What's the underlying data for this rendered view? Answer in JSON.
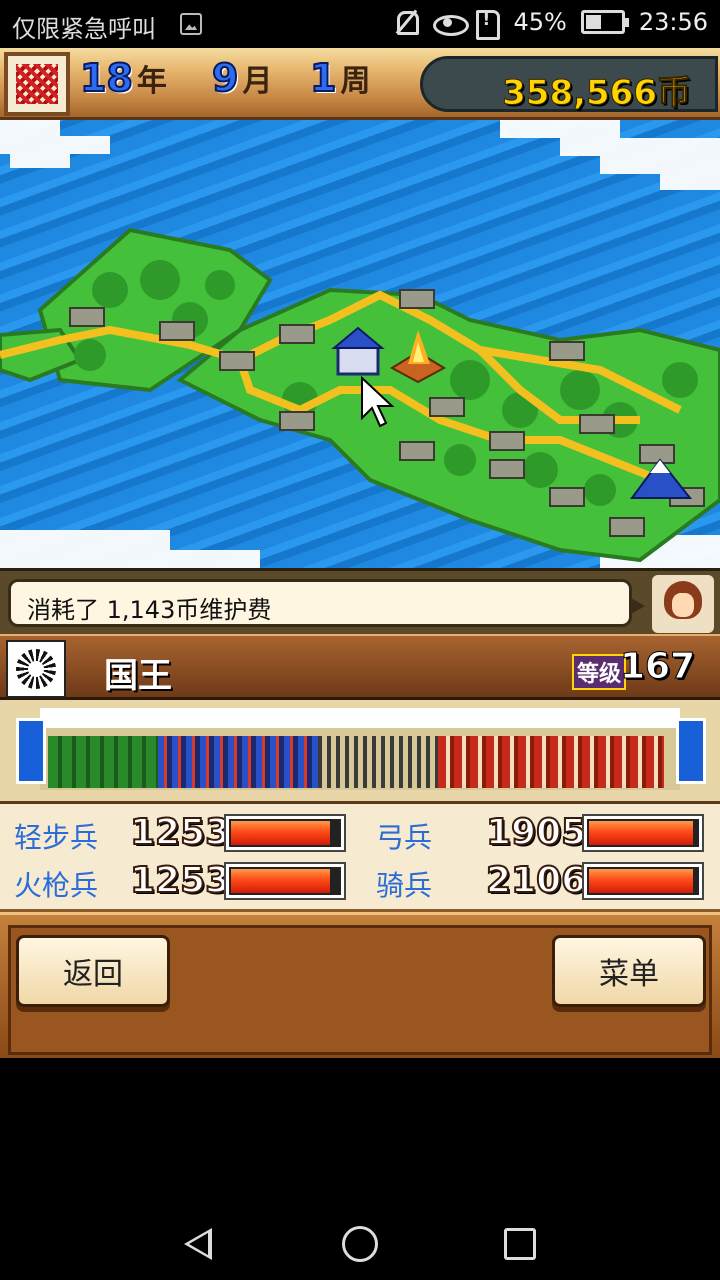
{
  "status_bar": {
    "carrier": "仅限紧急呼叫",
    "battery": "45%",
    "time": "23:56",
    "icons": [
      "image-icon",
      "mute-icon",
      "eye-icon",
      "sim-alert-icon",
      "battery-icon"
    ]
  },
  "header": {
    "year": "18",
    "year_unit": "年",
    "month": "9",
    "month_unit": "月",
    "week": "1",
    "week_unit": "周",
    "money": "358,566币"
  },
  "message": {
    "text": "消耗了 1,143币维护费"
  },
  "player": {
    "name": "国王",
    "level_label": "等级",
    "level": "167"
  },
  "army": {
    "units": [
      {
        "label": "轻步兵",
        "value": "1253",
        "fill": 0.92
      },
      {
        "label": "弓兵",
        "value": "1905",
        "fill": 0.96
      },
      {
        "label": "火枪兵",
        "value": "1253",
        "fill": 0.92
      },
      {
        "label": "骑兵",
        "value": "2106",
        "fill": 0.96
      }
    ]
  },
  "buttons": {
    "back": "返回",
    "menu": "菜单"
  },
  "colors": {
    "sea": "#1f88e0",
    "land": "#4cc83c",
    "road": "#f4c020",
    "money": "#ffd400",
    "stat_label": "#2a6cd8"
  }
}
